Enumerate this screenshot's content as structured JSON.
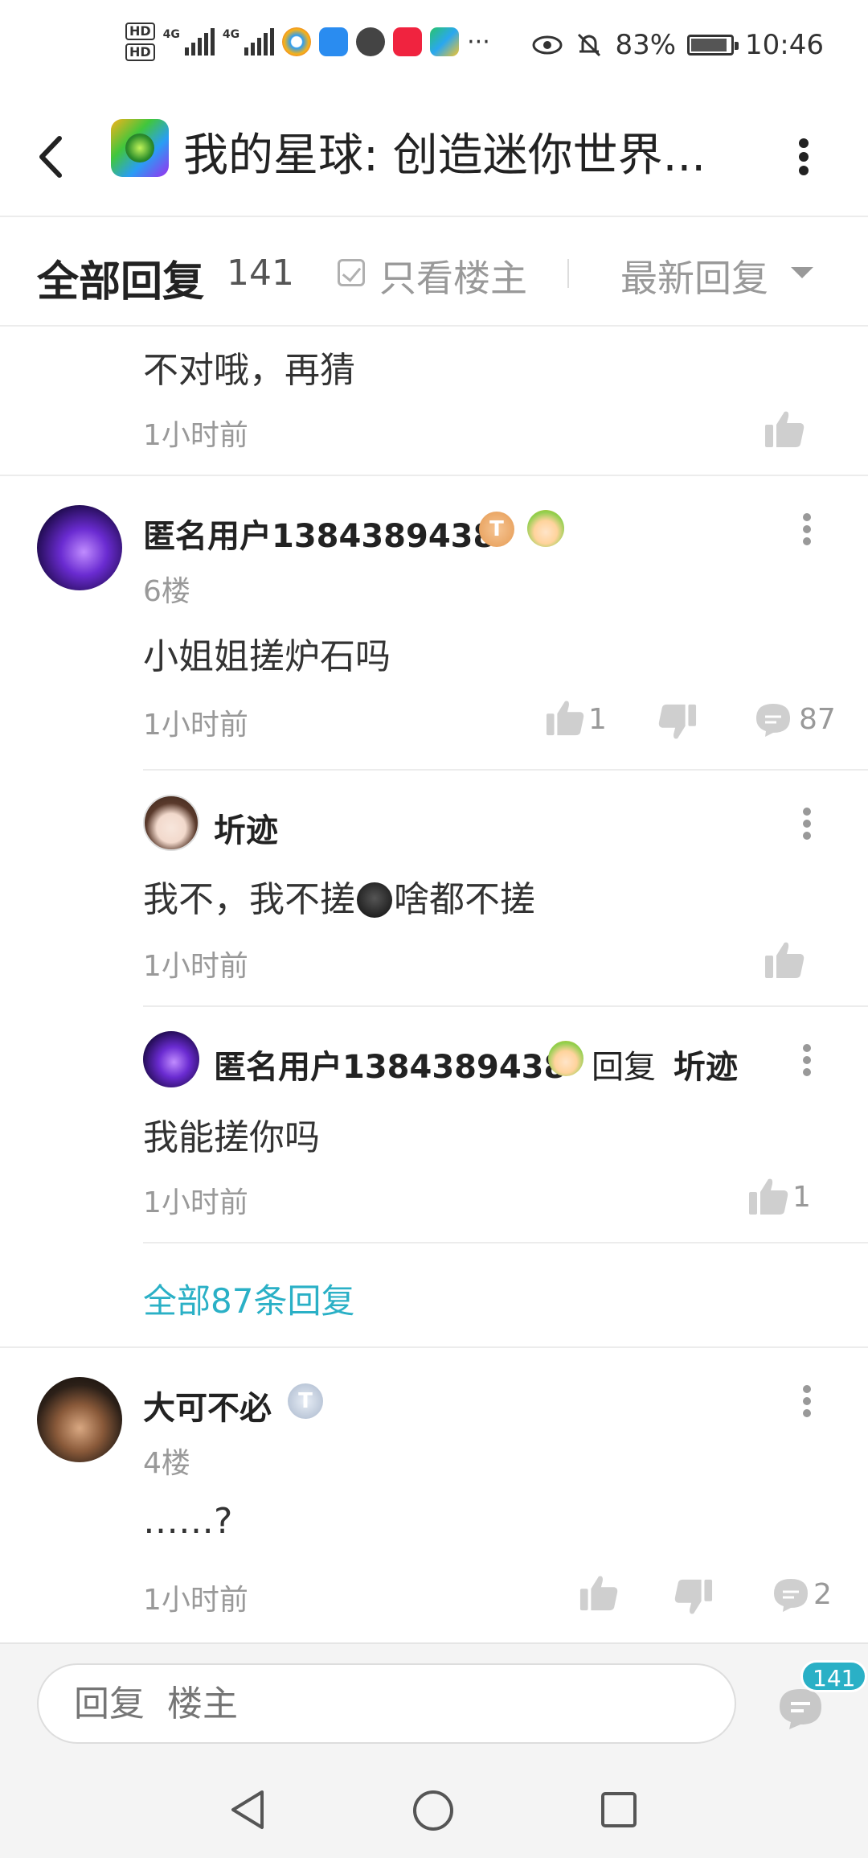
{
  "status_bar": {
    "hd1": "HD",
    "hd2": "HD",
    "net1": "4G",
    "net2": "4G",
    "more": "···",
    "battery_pct": "83%",
    "time": "10:46"
  },
  "header": {
    "title": "我的星球: 创造迷你世界..."
  },
  "filter": {
    "all_replies_label": "全部回复",
    "count": "141",
    "only_op_label": "只看楼主",
    "sort_label": "最新回复"
  },
  "comments": {
    "partial": {
      "content": "不对哦，再猜",
      "time": "1小时前"
    },
    "floor6": {
      "username": "匿名用户1384389438",
      "badge": "T",
      "floor": "6楼",
      "content": "小姐姐搓炉石吗",
      "time": "1小时前",
      "likes": "1",
      "comments": "87",
      "replies": [
        {
          "username": "圻迹",
          "content_before": "我不，我不搓",
          "content_after": "啥都不搓",
          "time": "1小时前"
        },
        {
          "username": "匿名用户1384389438",
          "reply_word": "回复",
          "reply_to": "圻迹",
          "content": "我能搓你吗",
          "time": "1小时前",
          "likes": "1"
        }
      ],
      "view_all": "全部87条回复"
    },
    "floor4": {
      "username": "大可不必",
      "badge": "T",
      "floor": "4楼",
      "content": "……?",
      "time": "1小时前",
      "comments": "2"
    }
  },
  "bottom": {
    "reply_placeholder": "回复  楼主",
    "message_count": "141"
  },
  "icons": {
    "back": "back-arrow-icon",
    "more": "more-vertical-icon",
    "like": "thumb-up-icon",
    "dislike": "thumb-down-icon",
    "comment": "comment-bubble-icon",
    "messages": "messages-icon",
    "nav_back": "nav-back-icon",
    "nav_home": "nav-home-icon",
    "nav_recent": "nav-recent-icon"
  },
  "colors": {
    "accent": "#2ab0c6",
    "text_primary": "#222222",
    "text_secondary": "#999999"
  }
}
